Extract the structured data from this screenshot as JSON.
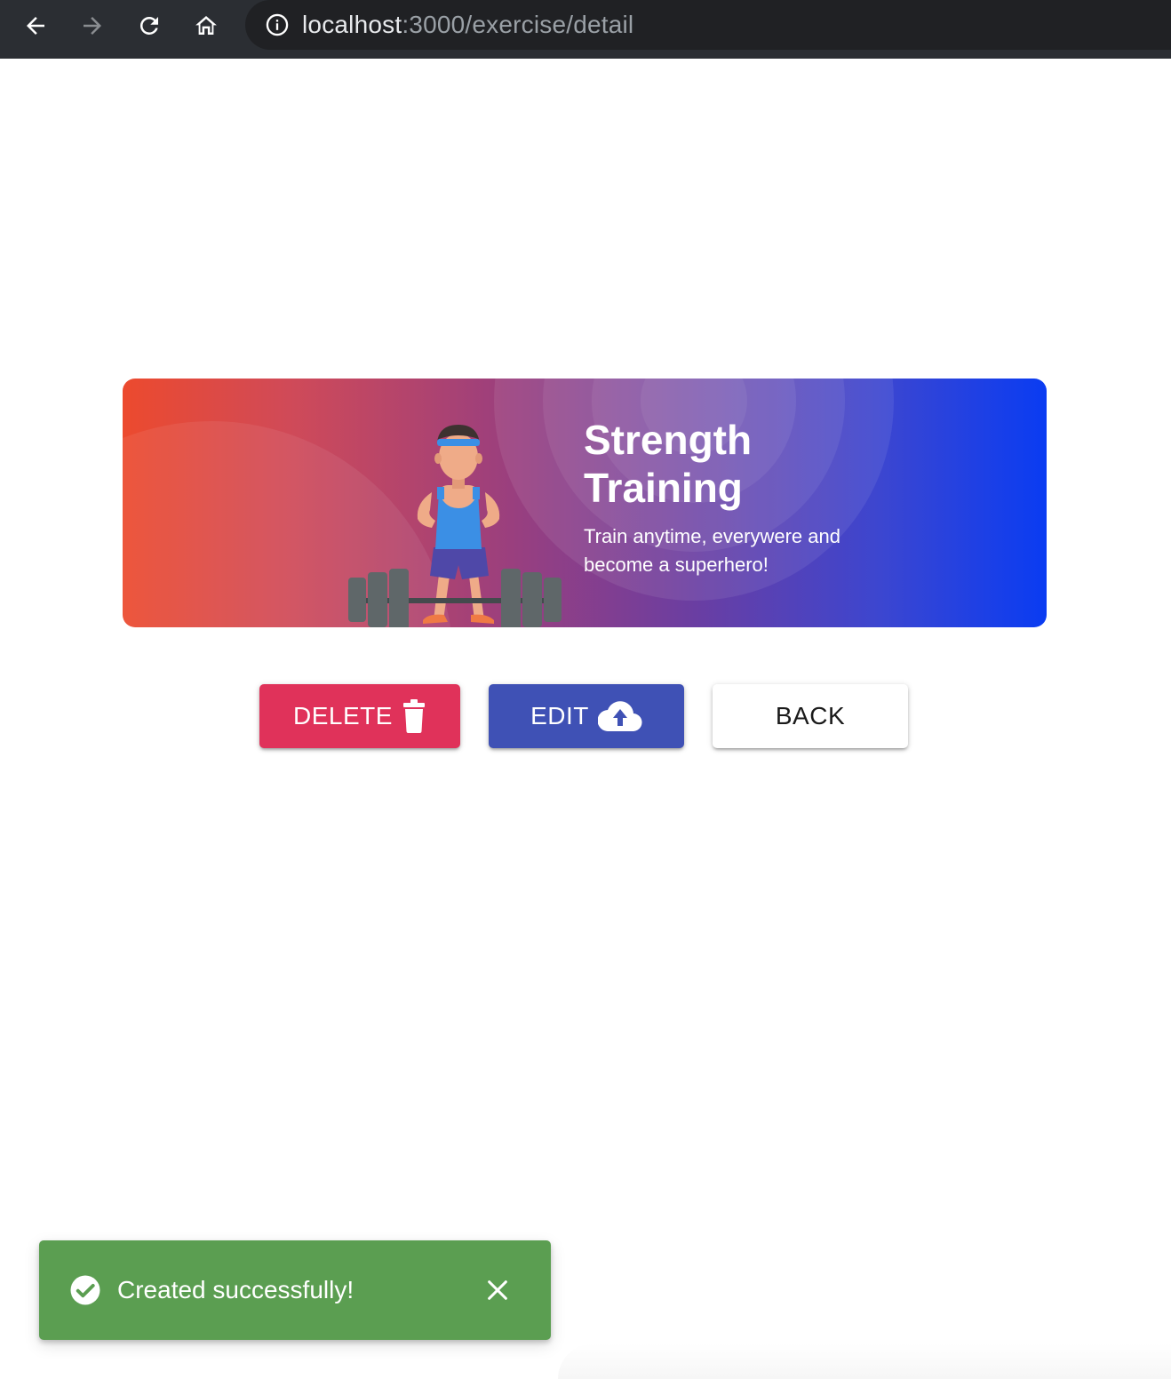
{
  "browser": {
    "url_host": "localhost",
    "url_path": ":3000/exercise/detail",
    "icons": [
      "back-arrow-icon",
      "forward-arrow-icon",
      "reload-icon",
      "home-icon",
      "info-icon"
    ]
  },
  "banner": {
    "title": "Strength Training",
    "subtitle": "Train anytime, everywere and become a superhero!",
    "colors": {
      "start": "#ec4a2e",
      "middle": "#7a3f98",
      "end": "#0a3cf2"
    }
  },
  "actions": {
    "delete_label": "DELETE",
    "edit_label": "EDIT",
    "back_label": "BACK",
    "delete_color": "#e0325a",
    "edit_color": "#3f51b5"
  },
  "snackbar": {
    "message": "Created successfully!",
    "color": "#5b9e51",
    "icons": [
      "check-circle-icon",
      "close-icon"
    ]
  }
}
